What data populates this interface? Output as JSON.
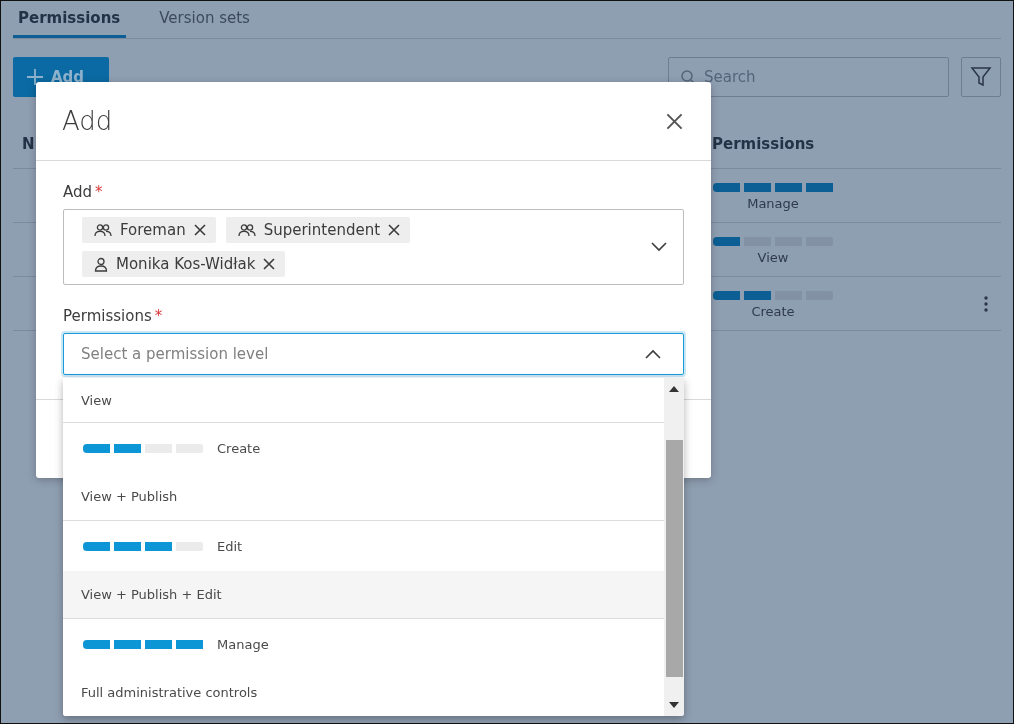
{
  "tabs": [
    {
      "label": "Permissions",
      "selected": true
    },
    {
      "label": "Version sets",
      "selected": false
    }
  ],
  "toolbar": {
    "add_button": "Add",
    "search": {
      "placeholder": "Search"
    }
  },
  "table": {
    "columns": [
      "N",
      "Permissions"
    ],
    "rows": [
      {
        "level": 1,
        "permission": "Manage",
        "menu": false
      },
      {
        "level": 0.25,
        "permission": "View",
        "menu": false
      },
      {
        "level": 0.5,
        "permission": "Create",
        "menu": true
      }
    ]
  },
  "dialog": {
    "title": "Add",
    "add_field": {
      "label": "Add",
      "required": true,
      "required_mark": "*",
      "chips": [
        {
          "kind": "group",
          "label": "Foreman"
        },
        {
          "kind": "group",
          "label": "Superintendent"
        },
        {
          "kind": "person",
          "label": "Monika Kos-Widłak"
        }
      ]
    },
    "permissions_field": {
      "label": "Permissions",
      "required": true,
      "required_mark": "*",
      "placeholder": "Select a permission level",
      "expanded": true
    },
    "options": [
      {
        "description": "View",
        "highlighted": false
      },
      {
        "name": "Create",
        "level": 0.5,
        "description": "View + Publish",
        "highlighted": false
      },
      {
        "name": "Edit",
        "level": 0.75,
        "description": "View + Publish + Edit",
        "highlighted": true
      },
      {
        "name": "Manage",
        "level": 1,
        "description": "Full administrative controls",
        "highlighted": false
      }
    ]
  }
}
